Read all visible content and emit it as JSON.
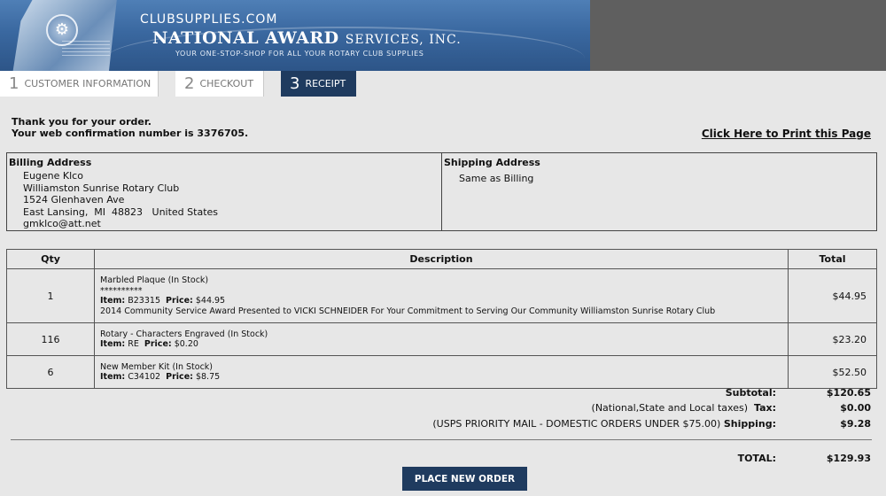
{
  "header": {
    "site": "CLUBSUPPLIES.COM",
    "brand_main": "NATIONAL AWARD",
    "brand_sub": "SERVICES, INC.",
    "tagline": "YOUR ONE-STOP-SHOP FOR ALL YOUR ROTARY CLUB SUPPLIES"
  },
  "steps": [
    {
      "num": "1",
      "label": "CUSTOMER INFORMATION",
      "active": false
    },
    {
      "num": "2",
      "label": "CHECKOUT",
      "active": false
    },
    {
      "num": "3",
      "label": "RECEIPT",
      "active": true
    }
  ],
  "confirmation": {
    "thanks": "Thank you for your order.",
    "number_text": "Your web confirmation number is 3376705."
  },
  "print_link": "Click Here to Print this Page",
  "billing": {
    "title": "Billing Address",
    "name": "Eugene Klco",
    "org": "Williamston Sunrise Rotary Club",
    "street": "1524 Glenhaven Ave",
    "city_line": "East Lansing,  MI  48823   United States",
    "email": "gmklco@att.net"
  },
  "shipping": {
    "title": "Shipping Address",
    "value": "Same as Billing"
  },
  "table": {
    "headers": {
      "qty": "Qty",
      "description": "Description",
      "total": "Total"
    },
    "item_label": "Item:",
    "price_label": "Price:",
    "rows": [
      {
        "qty": "1",
        "name": "Marbled Plaque  (In Stock)",
        "stars": "**********",
        "item": "B23315",
        "price": "$44.95",
        "note": "2014 Community Service Award Presented to VICKI SCHNEIDER For Your Commitment to Serving Our Community Williamston Sunrise Rotary Club",
        "total": "$44.95"
      },
      {
        "qty": "116",
        "name": "Rotary - Characters Engraved  (In Stock)",
        "item": "RE",
        "price": "$0.20",
        "total": "$23.20"
      },
      {
        "qty": "6",
        "name": "New Member Kit  (In Stock)",
        "item": "C34102",
        "price": "$8.75",
        "total": "$52.50"
      }
    ]
  },
  "totals": {
    "subtotal_label": "Subtotal:",
    "subtotal": "$120.65",
    "tax_note": "(National,State and Local taxes)",
    "tax_label": "Tax:",
    "tax": "$0.00",
    "shipping_note": "(USPS PRIORITY MAIL - DOMESTIC ORDERS UNDER $75.00)",
    "shipping_label": "Shipping:",
    "shipping": "$9.28",
    "total_label": "TOTAL:",
    "total": "$129.93"
  },
  "place_order_label": "PLACE NEW ORDER"
}
